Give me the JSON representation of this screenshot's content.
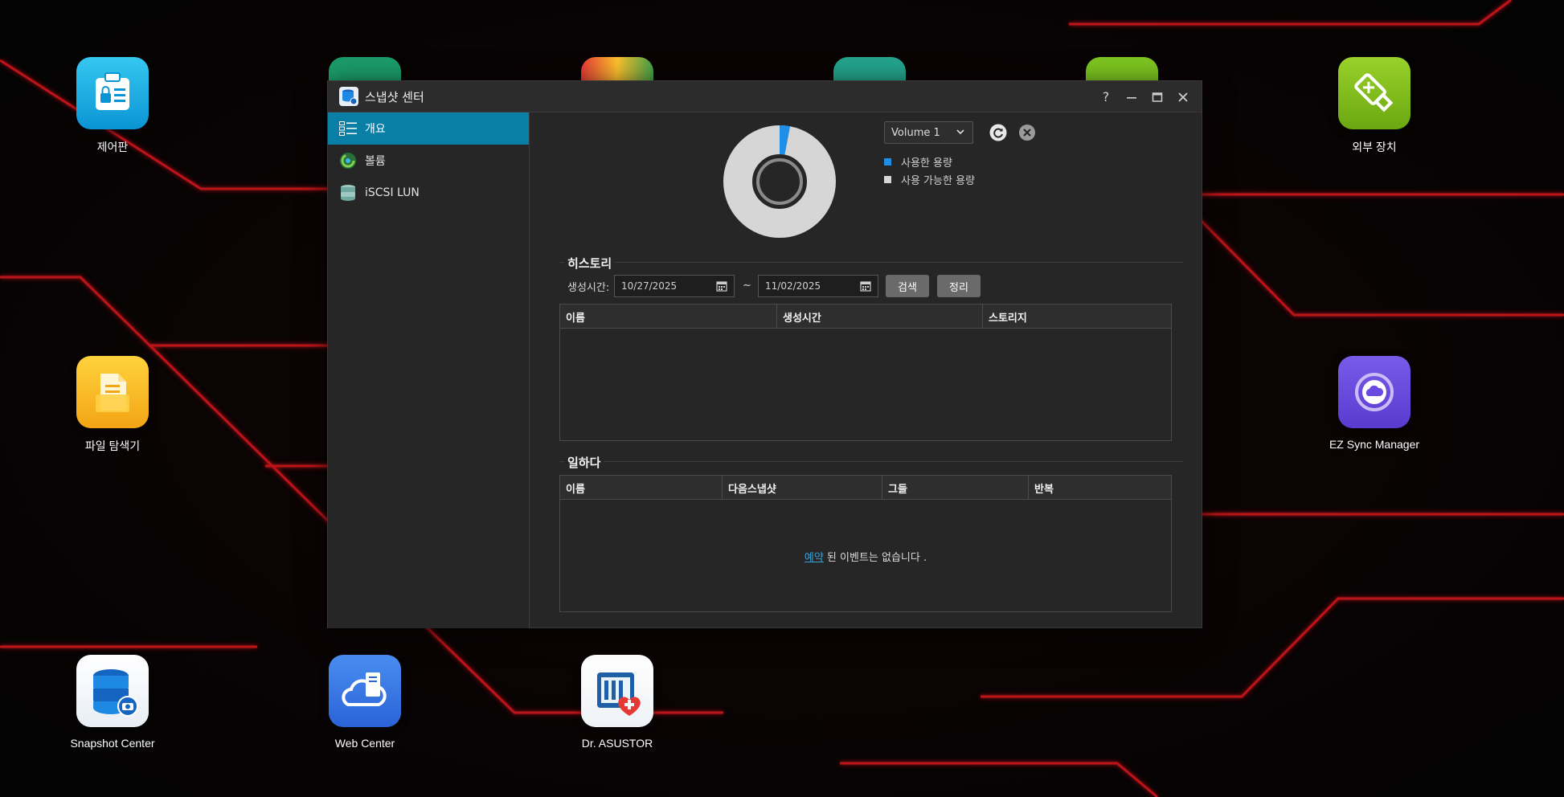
{
  "desktop": {
    "icons": [
      {
        "label": "제어판",
        "icon": "control-panel-icon"
      },
      {
        "label": "파일 탐색기",
        "icon": "file-explorer-icon"
      },
      {
        "label": "Snapshot Center",
        "icon": "snapshot-center-icon"
      },
      {
        "label": "Web Center",
        "icon": "web-center-icon"
      },
      {
        "label": "Dr. ASUSTOR",
        "icon": "dr-asustor-icon"
      },
      {
        "label": "외부 장치",
        "icon": "external-device-icon"
      },
      {
        "label": "EZ Sync Manager",
        "icon": "ez-sync-icon"
      }
    ]
  },
  "window": {
    "title": "스냅샷 센터",
    "controls": {
      "help": "?",
      "minimize": "minimize-icon",
      "maximize": "maximize-icon",
      "close": "close-icon"
    }
  },
  "sidebar": {
    "items": [
      {
        "label": "개요",
        "icon": "list-icon",
        "active": true
      },
      {
        "label": "볼륨",
        "icon": "volume-icon",
        "active": false
      },
      {
        "label": "iSCSI LUN",
        "icon": "database-icon",
        "active": false
      }
    ]
  },
  "overview": {
    "volume_select": "Volume 1",
    "usage": {
      "used_fraction": 0.03,
      "used_color": "#1e8ee6",
      "free_color": "#d6d6d6"
    },
    "legend": [
      {
        "label": "사용한 용량",
        "color": "#1e8ee6"
      },
      {
        "label": "사용 가능한 용량",
        "color": "#d6d6d6"
      }
    ]
  },
  "history": {
    "title": "히스토리",
    "created_label": "생성시간:",
    "date_from": "10/27/2025",
    "date_sep": "~",
    "date_to": "11/02/2025",
    "search_button": "검색",
    "clear_button": "정리",
    "columns": [
      "이름",
      "생성시간",
      "스토리지"
    ],
    "rows": []
  },
  "schedule": {
    "title": "일하다",
    "columns": [
      "이름",
      "다음스냅샷",
      "그들",
      "반복"
    ],
    "rows": [],
    "empty_link": "예약",
    "empty_text": " 된 이벤트는 없습니다 ."
  }
}
